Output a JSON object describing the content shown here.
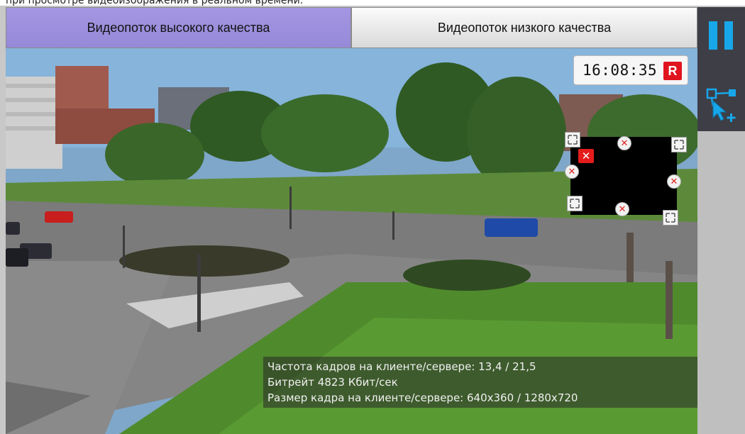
{
  "caption": "при просмотре видеоизображения в реальном времени.",
  "tabs": [
    {
      "label": "Видеопоток высокого качества",
      "active": true
    },
    {
      "label": "Видеопоток низкого качества",
      "active": false
    }
  ],
  "overlay": {
    "time": "16:08:35",
    "record_badge": "R"
  },
  "privacy_mask": {
    "delete_symbol": "✕",
    "vertex_symbol": "✕"
  },
  "stats": {
    "fps_line": "Частота кадров на клиенте/сервере: 13,4 / 21,5",
    "bitrate_line": "Битрейт 4823 Кбит/сек",
    "frame_size_line": "Размер кадра на клиенте/сервере: 640x360 / 1280x720"
  },
  "toolbar": {
    "pause_icon": "pause-icon",
    "add_zone_icon": "add-zone-icon"
  },
  "colors": {
    "active_tab": "#9a8cdb",
    "accent_blue": "#18a7ea",
    "record_red": "#e0141e"
  }
}
